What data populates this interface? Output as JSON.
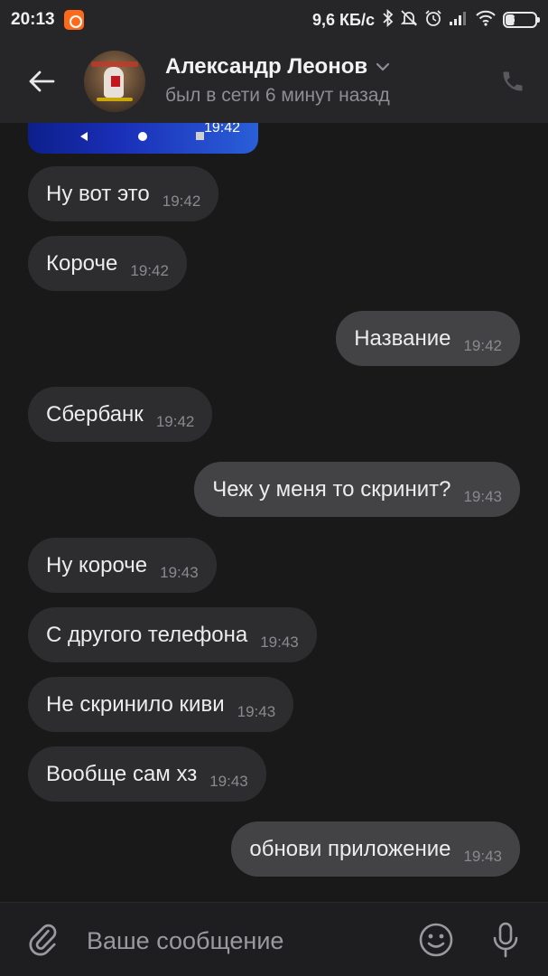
{
  "status_bar": {
    "time": "20:13",
    "network_speed": "9,6 КБ/с",
    "battery_level": "30",
    "battery_fraction": 0.3
  },
  "header": {
    "contact_name": "Александр Леонов",
    "contact_status": "был в сети 6 минут назад"
  },
  "image_message": {
    "time": "19:42"
  },
  "messages": [
    {
      "direction": "in",
      "text": "Ну вот это",
      "time": "19:42"
    },
    {
      "direction": "in",
      "text": "Короче",
      "time": "19:42"
    },
    {
      "direction": "out",
      "text": "Название",
      "time": "19:42"
    },
    {
      "direction": "in",
      "text": "Сбербанк",
      "time": "19:42"
    },
    {
      "direction": "out",
      "text": "Чеж у меня то скринит?",
      "time": "19:43"
    },
    {
      "direction": "in",
      "text": "Ну короче",
      "time": "19:43"
    },
    {
      "direction": "in",
      "text": "С другого телефона",
      "time": "19:43"
    },
    {
      "direction": "in",
      "text": "Не скринило киви",
      "time": "19:43"
    },
    {
      "direction": "in",
      "text": "Вообще сам хз",
      "time": "19:43"
    },
    {
      "direction": "out",
      "text": "обнови приложение",
      "time": "19:43"
    }
  ],
  "composer": {
    "placeholder": "Ваше сообщение"
  },
  "icons": {
    "back": "arrow-left-icon",
    "dropdown": "chevron-down-icon",
    "call": "phone-icon",
    "attach": "paperclip-icon",
    "emoji": "smiley-icon",
    "mic": "microphone-icon"
  },
  "colors": {
    "background": "#19191a",
    "header": "#262628",
    "incoming_bubble": "#2d2d2f",
    "outgoing_bubble": "#434345"
  }
}
